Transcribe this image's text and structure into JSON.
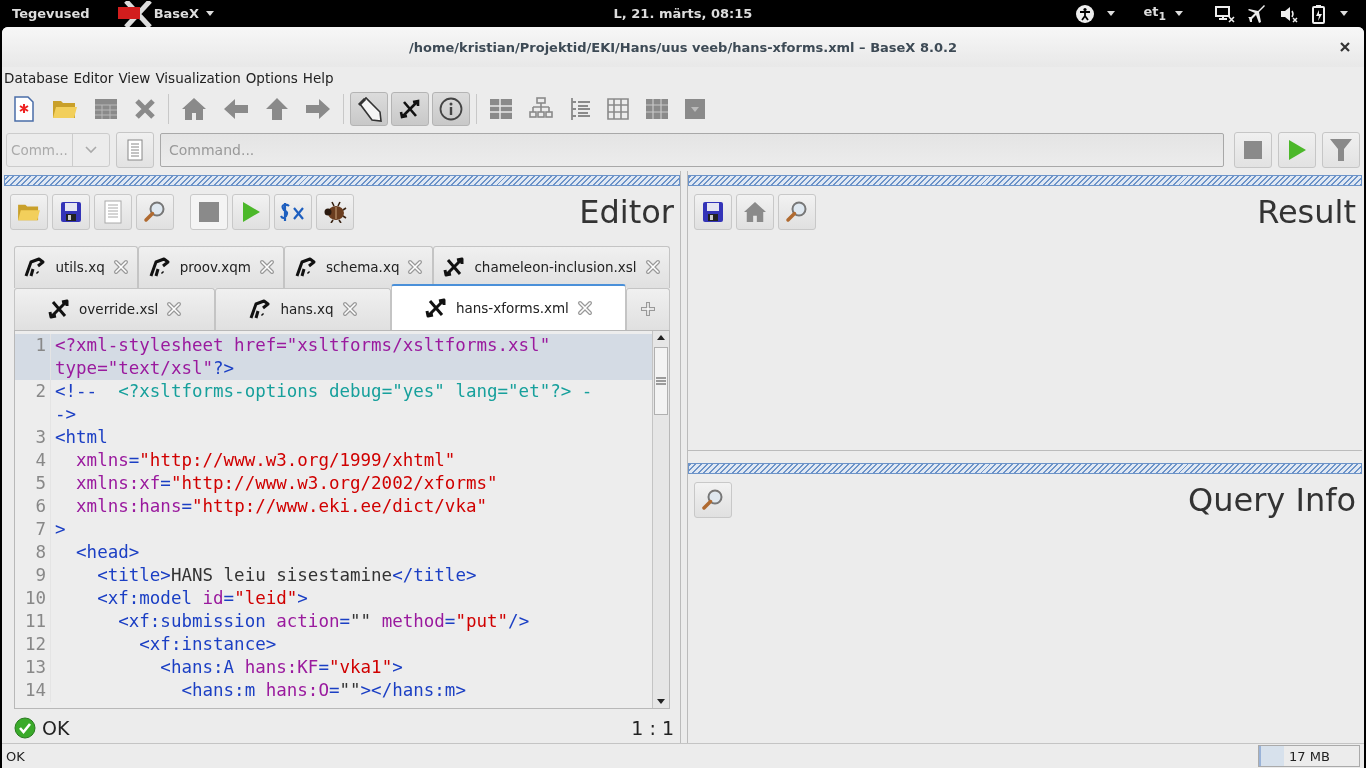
{
  "top_bar": {
    "activities": "Tegevused",
    "app_menu": "BaseX",
    "clock": "L, 21. märts, 08:15",
    "keyboard_layout": "et$_{1}$"
  },
  "window": {
    "title": "/home/kristian/Projektid/EKI/Hans/uus veeb/hans-xforms.xml – BaseX 8.0.2"
  },
  "menu": [
    "Database",
    "Editor",
    "View",
    "Visualization",
    "Options",
    "Help"
  ],
  "toolbar": {
    "toggles": [
      {
        "on": true
      },
      {
        "on": true
      },
      {
        "on": true
      }
    ]
  },
  "command_bar": {
    "mode": "Comm...",
    "placeholder": "Command..."
  },
  "editor": {
    "title": "Editor",
    "tab_rows": [
      {
        "tabs": [
          {
            "label": "utils.xq",
            "kind": "xquery",
            "selected": false
          },
          {
            "label": "proov.xqm",
            "kind": "xquery",
            "selected": false
          },
          {
            "label": "schema.xq",
            "kind": "xquery",
            "selected": false
          },
          {
            "label": "chameleon-inclusion.xsl",
            "kind": "xml",
            "selected": false
          }
        ]
      },
      {
        "tabs": [
          {
            "label": "override.xsl",
            "kind": "xml",
            "selected": false
          },
          {
            "label": "hans.xq",
            "kind": "xquery",
            "selected": false
          },
          {
            "label": "hans-xforms.xml",
            "kind": "xml",
            "selected": true
          }
        ]
      }
    ],
    "lines": [
      {
        "number": "1",
        "highlighted": true,
        "rows": [
          [
            {
              "kind": "attr",
              "text": "<?xml-stylesheet href=\"xsltforms/xsltforms.xsl\""
            }
          ],
          [
            {
              "kind": "attr",
              "text": "type=\"text/xsl\""
            },
            {
              "kind": "tag",
              "text": "?>"
            }
          ]
        ]
      },
      {
        "number": "2",
        "highlighted": false,
        "rows": [
          [
            {
              "kind": "tag",
              "text": "<!--"
            },
            {
              "kind": "comment",
              "text": "  <?xsltforms-options debug=\"yes\" lang=\"et\"?> -"
            }
          ],
          [
            {
              "kind": "tag",
              "text": "->"
            }
          ]
        ]
      },
      {
        "number": "3",
        "highlighted": false,
        "rows": [
          [
            {
              "kind": "tag",
              "text": "<html"
            }
          ]
        ]
      },
      {
        "number": "4",
        "highlighted": false,
        "rows": [
          [
            {
              "kind": "attr",
              "text": "  xmlns"
            },
            {
              "kind": "tag",
              "text": "="
            },
            {
              "kind": "value",
              "text": "\"http://www.w3.org/1999/xhtml\""
            }
          ]
        ]
      },
      {
        "number": "5",
        "highlighted": false,
        "rows": [
          [
            {
              "kind": "attr",
              "text": "  xmlns:xf"
            },
            {
              "kind": "tag",
              "text": "="
            },
            {
              "kind": "value",
              "text": "\"http://www.w3.org/2002/xforms\""
            }
          ]
        ]
      },
      {
        "number": "6",
        "highlighted": false,
        "rows": [
          [
            {
              "kind": "attr",
              "text": "  xmlns:hans"
            },
            {
              "kind": "tag",
              "text": "="
            },
            {
              "kind": "value",
              "text": "\"http://www.eki.ee/dict/vka\""
            }
          ]
        ]
      },
      {
        "number": "7",
        "highlighted": false,
        "rows": [
          [
            {
              "kind": "tag",
              "text": ">"
            }
          ]
        ]
      },
      {
        "number": "8",
        "highlighted": false,
        "rows": [
          [
            {
              "kind": "tag",
              "text": "  <head>"
            }
          ]
        ]
      },
      {
        "number": "9",
        "highlighted": false,
        "rows": [
          [
            {
              "kind": "tag",
              "text": "    <title>"
            },
            {
              "kind": "text",
              "text": "HANS leiu sisestamine"
            },
            {
              "kind": "tag",
              "text": "</title>"
            }
          ]
        ]
      },
      {
        "number": "10",
        "highlighted": false,
        "rows": [
          [
            {
              "kind": "tag",
              "text": "    <xf:model "
            },
            {
              "kind": "attr",
              "text": "id"
            },
            {
              "kind": "tag",
              "text": "="
            },
            {
              "kind": "value",
              "text": "\"leid\""
            },
            {
              "kind": "tag",
              "text": ">"
            }
          ]
        ]
      },
      {
        "number": "11",
        "highlighted": false,
        "rows": [
          [
            {
              "kind": "tag",
              "text": "      <xf:submission "
            },
            {
              "kind": "attr",
              "text": "action"
            },
            {
              "kind": "tag",
              "text": "="
            },
            {
              "kind": "text",
              "text": "\"\" "
            },
            {
              "kind": "attr",
              "text": "method"
            },
            {
              "kind": "tag",
              "text": "="
            },
            {
              "kind": "value",
              "text": "\"put\""
            },
            {
              "kind": "tag",
              "text": "/>"
            }
          ]
        ]
      },
      {
        "number": "12",
        "highlighted": false,
        "rows": [
          [
            {
              "kind": "tag",
              "text": "        <xf:instance>"
            }
          ]
        ]
      },
      {
        "number": "13",
        "highlighted": false,
        "rows": [
          [
            {
              "kind": "tag",
              "text": "          <hans:A "
            },
            {
              "kind": "attr",
              "text": "hans:KF"
            },
            {
              "kind": "tag",
              "text": "="
            },
            {
              "kind": "value",
              "text": "\"vka1\""
            },
            {
              "kind": "tag",
              "text": ">"
            }
          ]
        ]
      },
      {
        "number": "14",
        "highlighted": false,
        "rows": [
          [
            {
              "kind": "tag",
              "text": "            <hans:m "
            },
            {
              "kind": "attr",
              "text": "hans:O"
            },
            {
              "kind": "tag",
              "text": "="
            },
            {
              "kind": "text",
              "text": "\"\""
            },
            {
              "kind": "tag",
              "text": "></hans:m>"
            }
          ]
        ]
      }
    ],
    "status": "OK",
    "position": "1 : 1"
  },
  "result": {
    "title": "Result"
  },
  "query_info": {
    "title": "Query Info"
  },
  "status_bar": {
    "message": "OK",
    "memory": {
      "reading": "17 MB",
      "level": 0.25
    }
  }
}
